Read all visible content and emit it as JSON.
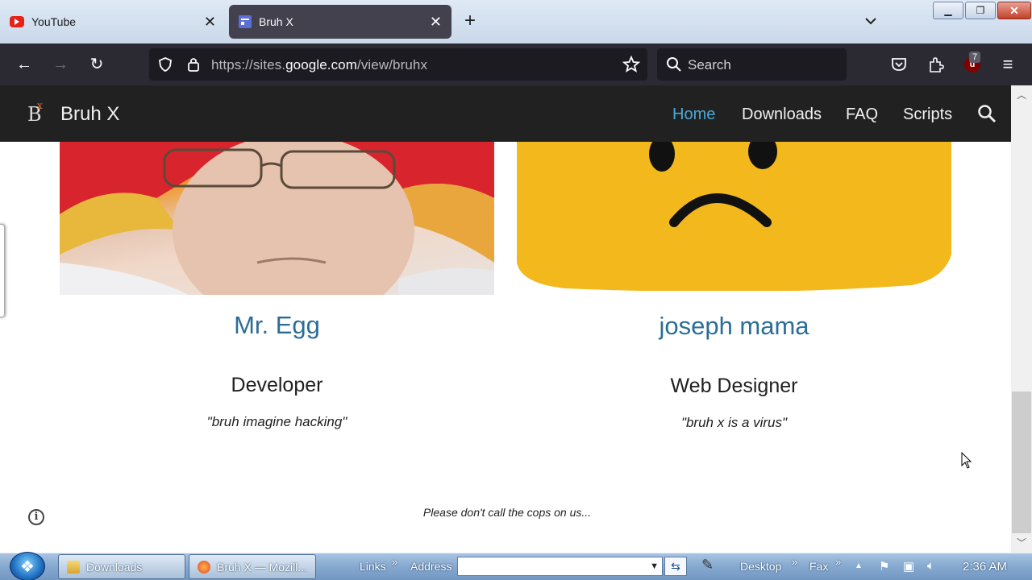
{
  "browser": {
    "tabs": [
      {
        "label": "YouTube",
        "favicon": "youtube-icon",
        "active": false
      },
      {
        "label": "Bruh X",
        "favicon": "google-sites-icon",
        "active": true
      }
    ],
    "url_prefix": "https://sites.",
    "url_domain": "google.com",
    "url_suffix": "/view/bruhx",
    "search_placeholder": "Search",
    "extension_badge": "7"
  },
  "site": {
    "logo_text": "B",
    "logo_mark": "x",
    "title": "Bruh X",
    "nav": [
      {
        "label": "Home",
        "active": true
      },
      {
        "label": "Downloads",
        "active": false
      },
      {
        "label": "FAQ",
        "active": false
      },
      {
        "label": "Scripts",
        "active": false
      }
    ]
  },
  "team": [
    {
      "name": "Mr. Egg",
      "role": "Developer",
      "quote": "\"bruh imagine hacking\""
    },
    {
      "name": "joseph mama",
      "role": "Web Designer",
      "quote": "\"bruh x is a virus\""
    }
  ],
  "footer_text": "Please don't call the cops on us...",
  "taskbar": {
    "items": [
      {
        "label": "Downloads"
      },
      {
        "label": "Bruh X — Mozill..."
      }
    ],
    "links_label": "Links",
    "address_label": "Address",
    "address_value": "",
    "desktop_label": "Desktop",
    "fax_label": "Fax",
    "clock": "2:36 AM"
  },
  "colors": {
    "accent_link": "#2b6e95",
    "nav_active": "#4aa9d6",
    "header_bg": "#212121",
    "browser_toolbar": "#2b2a33"
  }
}
